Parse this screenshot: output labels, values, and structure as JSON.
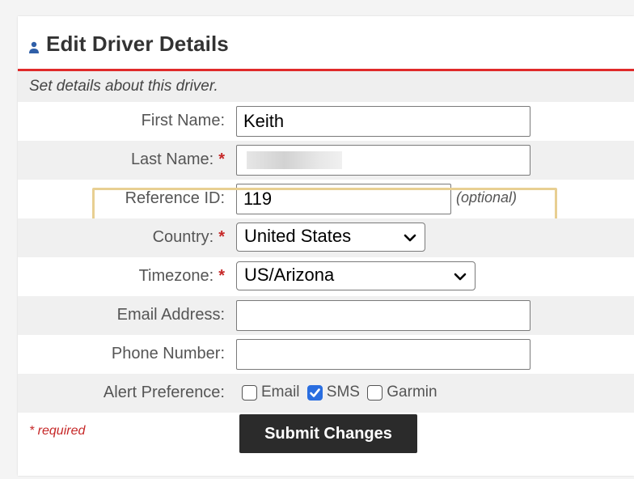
{
  "panel": {
    "title": "Edit Driver Details",
    "intro": "Set details about this driver."
  },
  "fields": {
    "first_name": {
      "label": "First Name:",
      "value": "Keith"
    },
    "last_name": {
      "label": "Last Name:",
      "required_marker": "*",
      "value": ""
    },
    "reference_id": {
      "label": "Reference ID:",
      "value": "119",
      "hint": "(optional)"
    },
    "country": {
      "label": "Country:",
      "required_marker": "*",
      "selected": "United States"
    },
    "timezone": {
      "label": "Timezone:",
      "required_marker": "*",
      "selected": "US/Arizona"
    },
    "email": {
      "label": "Email Address:",
      "value": ""
    },
    "phone": {
      "label": "Phone Number:",
      "value": ""
    },
    "alert_preference": {
      "label": "Alert Preference:",
      "options": [
        {
          "label": "Email",
          "checked": false
        },
        {
          "label": "SMS",
          "checked": true
        },
        {
          "label": "Garmin",
          "checked": false
        }
      ]
    }
  },
  "footer": {
    "required_note": "* required",
    "submit_label": "Submit Changes"
  },
  "colors": {
    "header_rule": "#e02a2a",
    "required_red": "#c62828",
    "highlight_outline": "#e8cf92",
    "checkbox_checked": "#2a6ee0",
    "submit_bg": "#2b2b2b"
  },
  "icons": {
    "header": "person-icon",
    "select_arrow": "chevron-down-icon",
    "checkmark": "checkmark-icon"
  }
}
